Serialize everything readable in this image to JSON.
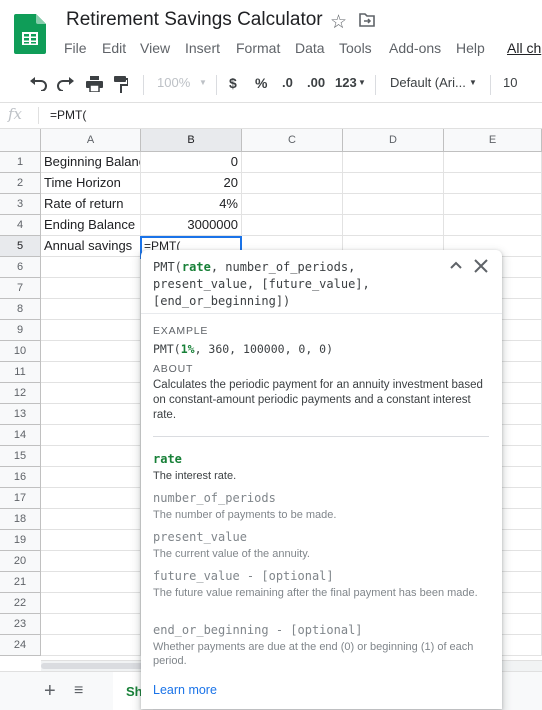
{
  "title_bar": {
    "title": "Retirement Savings Calculator",
    "star_icon": "star-icon",
    "move_icon": "move-to-folder-icon"
  },
  "menu": [
    "File",
    "Edit",
    "View",
    "Insert",
    "Format",
    "Data",
    "Tools",
    "Add-ons",
    "Help",
    "All ch"
  ],
  "toolbar": {
    "zoom": "100%",
    "currency": "$",
    "percent": "%",
    "decrease_decimals": ".0",
    "increase_decimals": ".00",
    "more_formats": "123",
    "font": "Default (Ari...",
    "font_size": "10"
  },
  "formula_bar": {
    "fx_label": "fx",
    "content": "=PMT("
  },
  "columns": [
    "A",
    "B",
    "C",
    "D",
    "E"
  ],
  "rows": [
    "1",
    "2",
    "3",
    "4",
    "5",
    "6",
    "7",
    "8",
    "9",
    "10",
    "11",
    "12",
    "13",
    "14",
    "15",
    "16",
    "17",
    "18",
    "19",
    "20",
    "21",
    "22",
    "23",
    "24"
  ],
  "cells": {
    "a1": "Beginning Balance",
    "b1": "0",
    "a2": "Time Horizon",
    "b2": "20",
    "a3": "Rate of return",
    "b3": "4%",
    "a4": "Ending Balance",
    "b4": "3000000",
    "a5": "Annual savings",
    "b5": "=PMT("
  },
  "tooltip": {
    "sig_fn": "PMT(",
    "sig_rate": "rate",
    "sig_rest_1": ", number_of_periods,",
    "sig_rest_2": "present_value, [future_value],",
    "sig_rest_3": "[end_or_beginning])",
    "example_label": "EXAMPLE",
    "example_fn": "PMT(",
    "example_first": "1%",
    "example_rest": ", 360, 100000, 0, 0)",
    "about_label": "ABOUT",
    "about_text": "Calculates the periodic payment for an annuity investment based on constant-amount periodic payments and a constant interest rate.",
    "params": [
      {
        "name": "rate",
        "desc": "The interest rate."
      },
      {
        "name": "number_of_periods",
        "desc": "The number of payments to be made."
      },
      {
        "name": "present_value",
        "desc": "The current value of the annuity."
      },
      {
        "name": "future_value - [optional]",
        "desc": "The future value remaining after the final payment has been made."
      },
      {
        "name": "end_or_beginning - [optional]",
        "desc": "Whether payments are due at the end (0) or beginning (1) of each period."
      }
    ],
    "learn_more": "Learn more"
  },
  "sheet_tab": {
    "label": "Sh"
  }
}
